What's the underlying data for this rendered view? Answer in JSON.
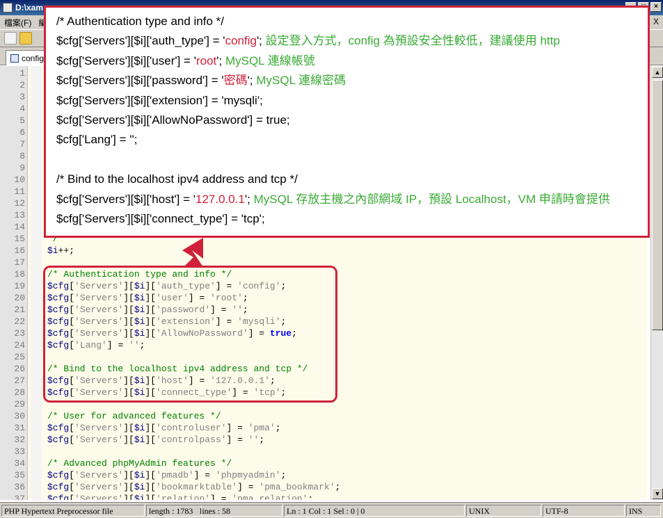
{
  "window": {
    "title": "D:\\xam",
    "menu": [
      "檔案(F)",
      "編"
    ],
    "menu_close": "X"
  },
  "tab": {
    "label": "config.i"
  },
  "editor": {
    "lines": [
      {
        "n": "1"
      },
      {
        "n": "2"
      },
      {
        "n": "3"
      },
      {
        "n": "4"
      },
      {
        "n": "5"
      },
      {
        "n": "6"
      },
      {
        "n": "7"
      },
      {
        "n": "8"
      },
      {
        "n": "9"
      },
      {
        "n": "10"
      },
      {
        "n": "11"
      },
      {
        "n": "12"
      },
      {
        "n": "13"
      },
      {
        "n": "14"
      },
      {
        "n": "15",
        "parts": [
          {
            "t": "*/",
            "c": "com"
          }
        ]
      },
      {
        "n": "16",
        "parts": [
          {
            "t": "$i",
            "c": "var"
          },
          {
            "t": "++;",
            "c": "op"
          }
        ]
      },
      {
        "n": "17"
      },
      {
        "n": "18",
        "parts": [
          {
            "t": "/* Authentication type and info */",
            "c": "com"
          }
        ]
      },
      {
        "n": "19",
        "parts": [
          {
            "t": "$cfg",
            "c": "var"
          },
          {
            "t": "[",
            "c": "op"
          },
          {
            "t": "'Servers'",
            "c": "str"
          },
          {
            "t": "][",
            "c": "op"
          },
          {
            "t": "$i",
            "c": "var"
          },
          {
            "t": "][",
            "c": "op"
          },
          {
            "t": "'auth_type'",
            "c": "str"
          },
          {
            "t": "] = ",
            "c": "op"
          },
          {
            "t": "'config'",
            "c": "str"
          },
          {
            "t": ";",
            "c": "op"
          }
        ]
      },
      {
        "n": "20",
        "parts": [
          {
            "t": "$cfg",
            "c": "var"
          },
          {
            "t": "[",
            "c": "op"
          },
          {
            "t": "'Servers'",
            "c": "str"
          },
          {
            "t": "][",
            "c": "op"
          },
          {
            "t": "$i",
            "c": "var"
          },
          {
            "t": "][",
            "c": "op"
          },
          {
            "t": "'user'",
            "c": "str"
          },
          {
            "t": "] = ",
            "c": "op"
          },
          {
            "t": "'root'",
            "c": "str"
          },
          {
            "t": ";",
            "c": "op"
          }
        ]
      },
      {
        "n": "21",
        "parts": [
          {
            "t": "$cfg",
            "c": "var"
          },
          {
            "t": "[",
            "c": "op"
          },
          {
            "t": "'Servers'",
            "c": "str"
          },
          {
            "t": "][",
            "c": "op"
          },
          {
            "t": "$i",
            "c": "var"
          },
          {
            "t": "][",
            "c": "op"
          },
          {
            "t": "'password'",
            "c": "str"
          },
          {
            "t": "] = ",
            "c": "op"
          },
          {
            "t": "''",
            "c": "str"
          },
          {
            "t": ";",
            "c": "op"
          }
        ]
      },
      {
        "n": "22",
        "parts": [
          {
            "t": "$cfg",
            "c": "var"
          },
          {
            "t": "[",
            "c": "op"
          },
          {
            "t": "'Servers'",
            "c": "str"
          },
          {
            "t": "][",
            "c": "op"
          },
          {
            "t": "$i",
            "c": "var"
          },
          {
            "t": "][",
            "c": "op"
          },
          {
            "t": "'extension'",
            "c": "str"
          },
          {
            "t": "] = ",
            "c": "op"
          },
          {
            "t": "'mysqli'",
            "c": "str"
          },
          {
            "t": ";",
            "c": "op"
          }
        ]
      },
      {
        "n": "23",
        "parts": [
          {
            "t": "$cfg",
            "c": "var"
          },
          {
            "t": "[",
            "c": "op"
          },
          {
            "t": "'Servers'",
            "c": "str"
          },
          {
            "t": "][",
            "c": "op"
          },
          {
            "t": "$i",
            "c": "var"
          },
          {
            "t": "][",
            "c": "op"
          },
          {
            "t": "'AllowNoPassword'",
            "c": "str"
          },
          {
            "t": "] = ",
            "c": "op"
          },
          {
            "t": "true",
            "c": "kw"
          },
          {
            "t": ";",
            "c": "op"
          }
        ]
      },
      {
        "n": "24",
        "parts": [
          {
            "t": "$cfg",
            "c": "var"
          },
          {
            "t": "[",
            "c": "op"
          },
          {
            "t": "'Lang'",
            "c": "str"
          },
          {
            "t": "] = ",
            "c": "op"
          },
          {
            "t": "''",
            "c": "str"
          },
          {
            "t": ";",
            "c": "op"
          }
        ]
      },
      {
        "n": "25"
      },
      {
        "n": "26",
        "parts": [
          {
            "t": "/* Bind to the localhost ipv4 address and tcp */",
            "c": "com"
          }
        ]
      },
      {
        "n": "27",
        "parts": [
          {
            "t": "$cfg",
            "c": "var"
          },
          {
            "t": "[",
            "c": "op"
          },
          {
            "t": "'Servers'",
            "c": "str"
          },
          {
            "t": "][",
            "c": "op"
          },
          {
            "t": "$i",
            "c": "var"
          },
          {
            "t": "][",
            "c": "op"
          },
          {
            "t": "'host'",
            "c": "str"
          },
          {
            "t": "] = ",
            "c": "op"
          },
          {
            "t": "'127.0.0.1'",
            "c": "str"
          },
          {
            "t": ";",
            "c": "op"
          }
        ]
      },
      {
        "n": "28",
        "parts": [
          {
            "t": "$cfg",
            "c": "var"
          },
          {
            "t": "[",
            "c": "op"
          },
          {
            "t": "'Servers'",
            "c": "str"
          },
          {
            "t": "][",
            "c": "op"
          },
          {
            "t": "$i",
            "c": "var"
          },
          {
            "t": "][",
            "c": "op"
          },
          {
            "t": "'connect_type'",
            "c": "str"
          },
          {
            "t": "] = ",
            "c": "op"
          },
          {
            "t": "'tcp'",
            "c": "str"
          },
          {
            "t": ";",
            "c": "op"
          }
        ]
      },
      {
        "n": "29"
      },
      {
        "n": "30",
        "parts": [
          {
            "t": "/* User for advanced features */",
            "c": "com"
          }
        ]
      },
      {
        "n": "31",
        "parts": [
          {
            "t": "$cfg",
            "c": "var"
          },
          {
            "t": "[",
            "c": "op"
          },
          {
            "t": "'Servers'",
            "c": "str"
          },
          {
            "t": "][",
            "c": "op"
          },
          {
            "t": "$i",
            "c": "var"
          },
          {
            "t": "][",
            "c": "op"
          },
          {
            "t": "'controluser'",
            "c": "str"
          },
          {
            "t": "] = ",
            "c": "op"
          },
          {
            "t": "'pma'",
            "c": "str"
          },
          {
            "t": ";",
            "c": "op"
          }
        ]
      },
      {
        "n": "32",
        "parts": [
          {
            "t": "$cfg",
            "c": "var"
          },
          {
            "t": "[",
            "c": "op"
          },
          {
            "t": "'Servers'",
            "c": "str"
          },
          {
            "t": "][",
            "c": "op"
          },
          {
            "t": "$i",
            "c": "var"
          },
          {
            "t": "][",
            "c": "op"
          },
          {
            "t": "'controlpass'",
            "c": "str"
          },
          {
            "t": "] = ",
            "c": "op"
          },
          {
            "t": "''",
            "c": "str"
          },
          {
            "t": ";",
            "c": "op"
          }
        ]
      },
      {
        "n": "33"
      },
      {
        "n": "34",
        "parts": [
          {
            "t": "/* Advanced phpMyAdmin features */",
            "c": "com"
          }
        ]
      },
      {
        "n": "35",
        "parts": [
          {
            "t": "$cfg",
            "c": "var"
          },
          {
            "t": "[",
            "c": "op"
          },
          {
            "t": "'Servers'",
            "c": "str"
          },
          {
            "t": "][",
            "c": "op"
          },
          {
            "t": "$i",
            "c": "var"
          },
          {
            "t": "][",
            "c": "op"
          },
          {
            "t": "'pmadb'",
            "c": "str"
          },
          {
            "t": "] = ",
            "c": "op"
          },
          {
            "t": "'phpmyadmin'",
            "c": "str"
          },
          {
            "t": ";",
            "c": "op"
          }
        ]
      },
      {
        "n": "36",
        "parts": [
          {
            "t": "$cfg",
            "c": "var"
          },
          {
            "t": "[",
            "c": "op"
          },
          {
            "t": "'Servers'",
            "c": "str"
          },
          {
            "t": "][",
            "c": "op"
          },
          {
            "t": "$i",
            "c": "var"
          },
          {
            "t": "][",
            "c": "op"
          },
          {
            "t": "'bookmarktable'",
            "c": "str"
          },
          {
            "t": "] = ",
            "c": "op"
          },
          {
            "t": "'pma_bookmark'",
            "c": "str"
          },
          {
            "t": ";",
            "c": "op"
          }
        ]
      },
      {
        "n": "37",
        "parts": [
          {
            "t": "$cfg",
            "c": "var"
          },
          {
            "t": "[",
            "c": "op"
          },
          {
            "t": "'Servers'",
            "c": "str"
          },
          {
            "t": "][",
            "c": "op"
          },
          {
            "t": "$i",
            "c": "var"
          },
          {
            "t": "][",
            "c": "op"
          },
          {
            "t": "'relation'",
            "c": "str"
          },
          {
            "t": "] = ",
            "c": "op"
          },
          {
            "t": "'pma_relation'",
            "c": "str"
          },
          {
            "t": ";",
            "c": "op"
          }
        ]
      }
    ]
  },
  "callout": {
    "lines": [
      [
        {
          "t": "/* Authentication type and info */",
          "c": ""
        }
      ],
      [
        {
          "t": "$cfg['Servers'][$i]['auth_type'] = '",
          "c": ""
        },
        {
          "t": "config",
          "c": "red"
        },
        {
          "t": "';  ",
          "c": ""
        },
        {
          "t": "設定登入方式，config 為預設安全性較低，建議使用 http",
          "c": "green"
        }
      ],
      [
        {
          "t": "$cfg['Servers'][$i]['user'] = '",
          "c": ""
        },
        {
          "t": "root",
          "c": "red"
        },
        {
          "t": "'; ",
          "c": ""
        },
        {
          "t": "MySQL 連線帳號",
          "c": "green"
        }
      ],
      [
        {
          "t": "$cfg['Servers'][$i]['password'] = '",
          "c": ""
        },
        {
          "t": "密碼",
          "c": "red"
        },
        {
          "t": "'; ",
          "c": ""
        },
        {
          "t": "MySQL 連線密碼",
          "c": "green"
        }
      ],
      [
        {
          "t": "$cfg['Servers'][$i]['extension'] = 'mysqli';",
          "c": ""
        }
      ],
      [
        {
          "t": "$cfg['Servers'][$i]['AllowNoPassword'] = true;",
          "c": ""
        }
      ],
      [
        {
          "t": "$cfg['Lang'] = '';",
          "c": ""
        }
      ],
      [],
      [
        {
          "t": "/* Bind to the localhost ipv4 address and tcp */",
          "c": ""
        }
      ],
      [
        {
          "t": "$cfg['Servers'][$i]['host'] = '",
          "c": ""
        },
        {
          "t": "127.0.0.1",
          "c": "red"
        },
        {
          "t": "'; ",
          "c": ""
        },
        {
          "t": "MySQL 存放主機之內部網域 IP，預設 Localhost，VM 申請時會提供",
          "c": "green"
        }
      ],
      [
        {
          "t": "$cfg['Servers'][$i]['connect_type'] = 'tcp';",
          "c": ""
        }
      ]
    ]
  },
  "statusbar": {
    "language": "PHP Hypertext Preprocessor file",
    "length": "length : 1783",
    "lines": "lines : 58",
    "position": "Ln : 1    Col : 1    Sel : 0 | 0",
    "eol": "UNIX",
    "encoding": "UTF-8",
    "mode": "INS"
  },
  "colors": {
    "accent_red": "#d0213a",
    "annotation_green": "#3aaa35",
    "editor_bg": "#fdfbe9"
  }
}
